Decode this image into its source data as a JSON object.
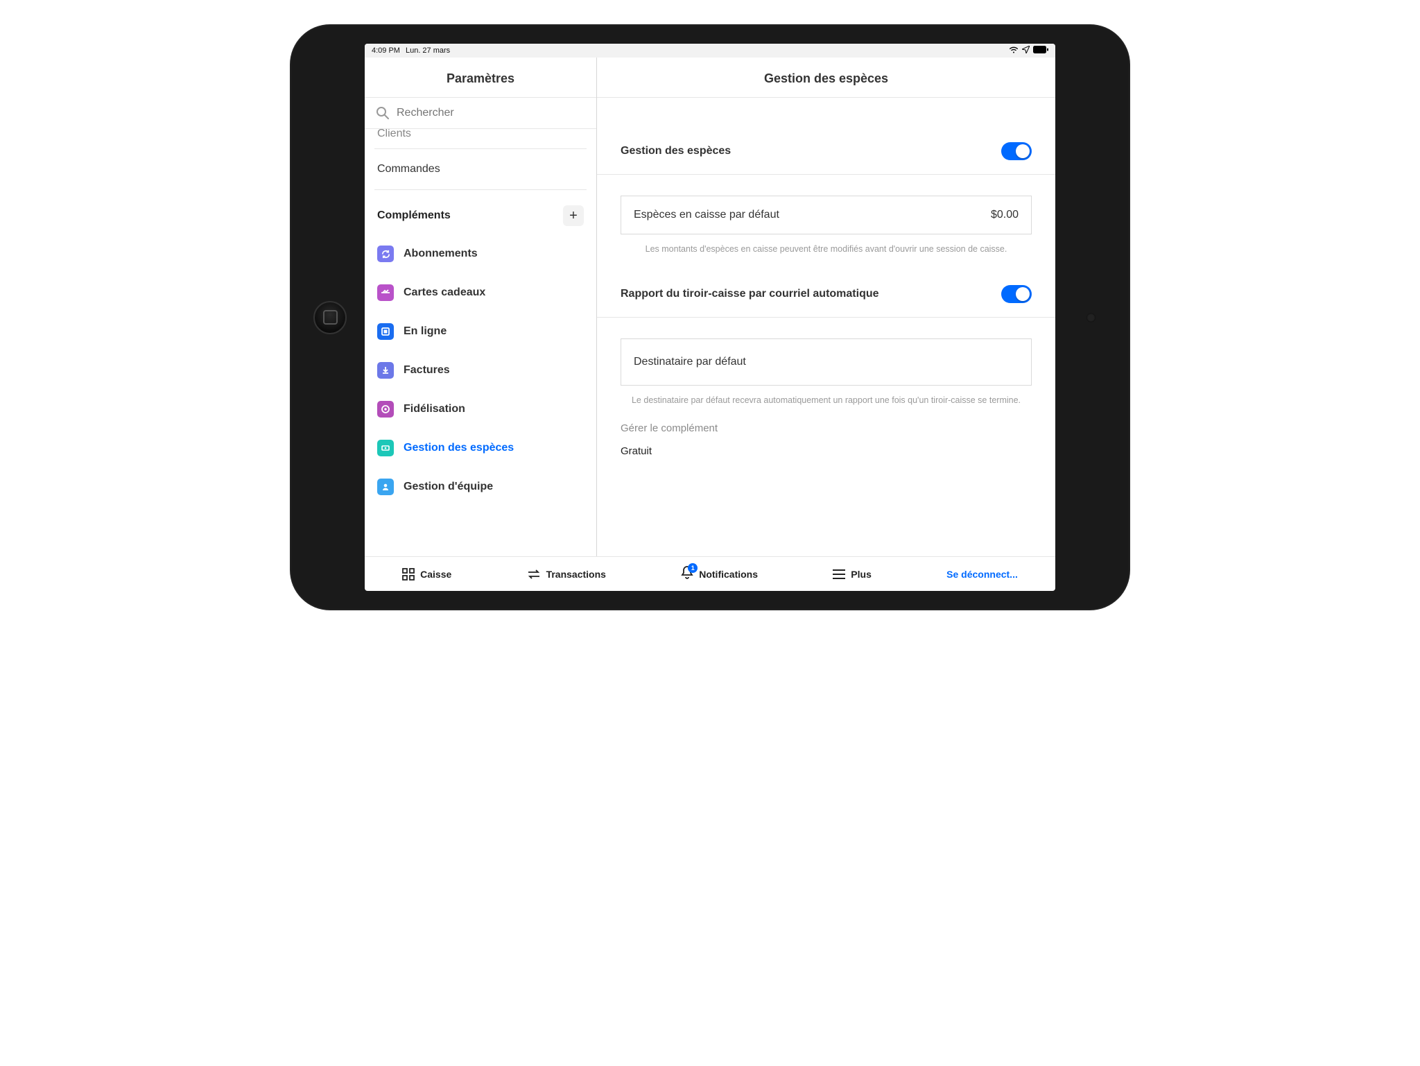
{
  "status": {
    "time": "4:09 PM",
    "date": "Lun. 27 mars"
  },
  "sidebar": {
    "title": "Paramètres",
    "search_placeholder": "Rechercher",
    "cutoff_item": "Clients",
    "plain_item": "Commandes",
    "section_label": "Compléments",
    "items": [
      {
        "label": "Abonnements"
      },
      {
        "label": "Cartes cadeaux"
      },
      {
        "label": "En ligne"
      },
      {
        "label": "Factures"
      },
      {
        "label": "Fidélisation"
      },
      {
        "label": "Gestion des espèces"
      },
      {
        "label": "Gestion d'équipe"
      }
    ]
  },
  "main": {
    "title": "Gestion des espèces",
    "toggle1_label": "Gestion des espèces",
    "default_cash_label": "Espèces en caisse par défaut",
    "default_cash_value": "$0.00",
    "hint1": "Les montants d'espèces en caisse peuvent être modifiés avant d'ouvrir une session de caisse.",
    "toggle2_label": "Rapport du tiroir-caisse par courriel automatique",
    "recipient_label": "Destinataire par défaut",
    "hint2": "Le destinataire par défaut recevra automatiquement un rapport une fois qu'un tiroir-caisse se termine.",
    "manage_label": "Gérer le complément",
    "manage_value": "Gratuit"
  },
  "tabs": {
    "caisse": "Caisse",
    "transactions": "Transactions",
    "notifications": "Notifications",
    "plus": "Plus",
    "logout": "Se déconnect...",
    "badge": "1"
  }
}
